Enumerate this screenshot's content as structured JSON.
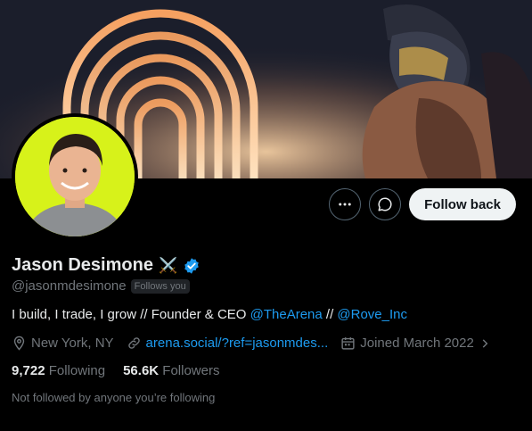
{
  "profile": {
    "name": "Jason Desimone",
    "name_emoji": "⚔️",
    "handle": "@jasonmdesimone",
    "follows_you": "Follows you",
    "bio_prefix": "I build, I trade, I grow // Founder & CEO ",
    "bio_link1": "@TheArena",
    "bio_sep": " // ",
    "bio_link2": "@Rove_Inc",
    "location": "New York, NY",
    "website": "arena.social/?ref=jasonmdes...",
    "joined": "Joined March 2022",
    "following_count": "9,722",
    "following_label": "Following",
    "followers_count": "56.6K",
    "followers_label": "Followers",
    "not_followed": "Not followed by anyone you’re following"
  },
  "actions": {
    "follow_back": "Follow back"
  },
  "colors": {
    "accent": "#1d9bf0",
    "background": "#000000",
    "muted": "#71767b",
    "avatar_bg": "#d7f21a"
  },
  "icons": [
    "more-icon",
    "message-icon",
    "verified-icon",
    "location-icon",
    "link-icon",
    "calendar-icon",
    "chevron-right-icon"
  ]
}
